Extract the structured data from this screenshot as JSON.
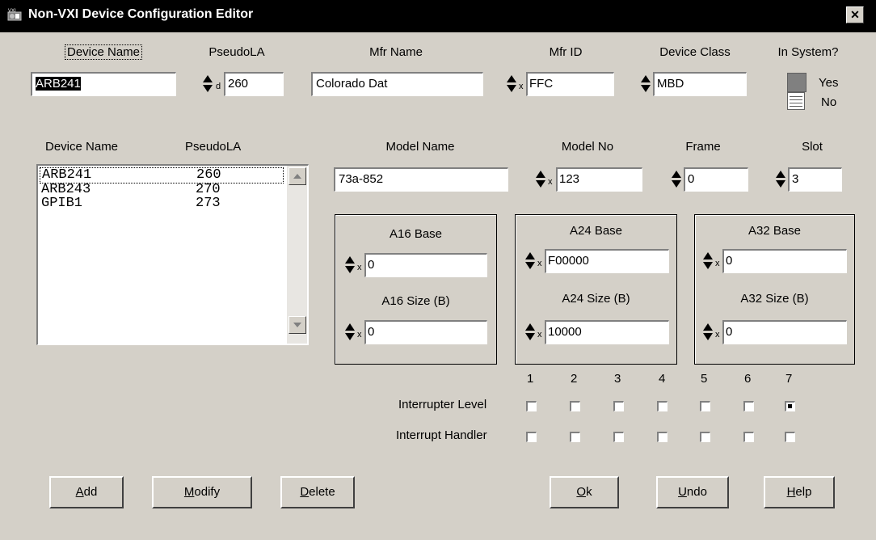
{
  "window": {
    "title": "Non-VXI Device Configuration Editor",
    "close_label": "✕"
  },
  "header_labels": {
    "device_name": "Device Name",
    "pseudo_la": "PseudoLA",
    "mfr_name": "Mfr Name",
    "mfr_id": "Mfr ID",
    "device_class": "Device Class",
    "in_system": "In System?"
  },
  "fields": {
    "device_name": "ARB241",
    "pseudo_la": "260",
    "pseudo_la_radix": "d",
    "mfr_name": "Colorado Dat",
    "mfr_id": "FFC",
    "mfr_id_radix": "x",
    "device_class": "MBD"
  },
  "in_system": {
    "yes_label": "Yes",
    "no_label": "No",
    "selected": "No"
  },
  "list": {
    "col_device_name": "Device Name",
    "col_pseudo_la": "PseudoLA",
    "rows": [
      {
        "name": "ARB241",
        "la": "260"
      },
      {
        "name": "ARB243",
        "la": "270"
      },
      {
        "name": "GPIB1",
        "la": "273"
      }
    ]
  },
  "model": {
    "model_name_label": "Model Name",
    "model_no_label": "Model No",
    "frame_label": "Frame",
    "slot_label": "Slot",
    "model_name": "73a-852",
    "model_no": "123",
    "model_no_radix": "x",
    "frame": "0",
    "slot": "3"
  },
  "address": {
    "a16": {
      "base_label": "A16 Base",
      "base": "0",
      "size_label": "A16 Size (B)",
      "size": "0",
      "radix": "x"
    },
    "a24": {
      "base_label": "A24 Base",
      "base": "F00000",
      "size_label": "A24 Size (B)",
      "size": "10000",
      "radix": "x"
    },
    "a32": {
      "base_label": "A32 Base",
      "base": "0",
      "size_label": "A32 Size (B)",
      "size": "0",
      "radix": "x"
    }
  },
  "interrupts": {
    "levels": [
      "1",
      "2",
      "3",
      "4",
      "5",
      "6",
      "7"
    ],
    "interrupter_label": "Interrupter Level",
    "handler_label": "Interrupt Handler",
    "interrupter_checked": [
      false,
      false,
      false,
      false,
      false,
      false,
      true
    ],
    "handler_checked": [
      false,
      false,
      false,
      false,
      false,
      false,
      false
    ]
  },
  "buttons": {
    "add": "Add",
    "modify": "Modify",
    "delete": "Delete",
    "ok": "Ok",
    "undo": "Undo",
    "help": "Help"
  }
}
